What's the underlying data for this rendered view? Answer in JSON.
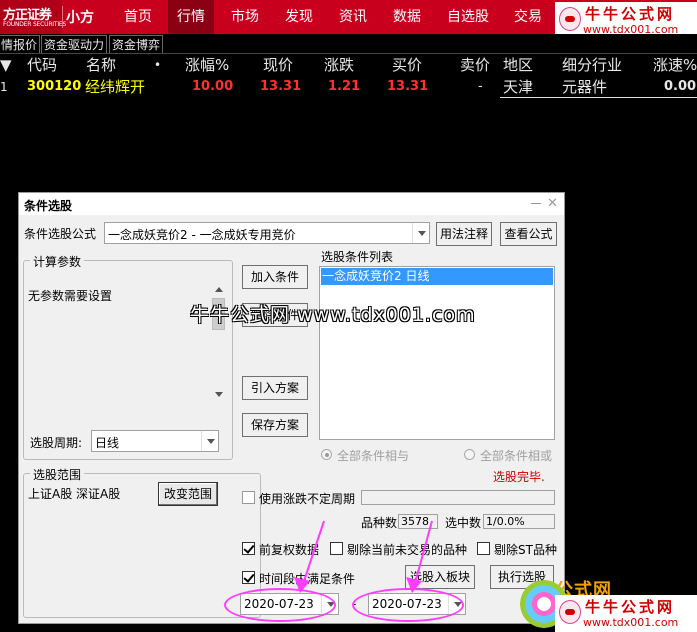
{
  "app": {
    "logo_main": "方正证券",
    "logo_sub": "FOUNDER SECURITIES",
    "logo_app": "小方"
  },
  "nav": {
    "items": [
      "首页",
      "行情",
      "市场",
      "发现",
      "资讯",
      "数据",
      "自选股",
      "交易"
    ],
    "active": "行情"
  },
  "brand": {
    "title": "牛牛公式网",
    "url": "www.tdx001.com"
  },
  "subtabs": [
    "情报价",
    "资金驱动力",
    "资金博弈"
  ],
  "table": {
    "headers": [
      "代码",
      "名称",
      "•",
      "涨幅%",
      "现价",
      "涨跌",
      "买价",
      "卖价",
      "地区",
      "细分行业",
      "涨速%"
    ],
    "row": {
      "index": "1",
      "code": "300120",
      "name": "经纬辉开",
      "change_pct": "10.00",
      "price": "13.31",
      "change": "1.21",
      "bid": "13.31",
      "ask": "-",
      "region": "天津",
      "industry": "元器件",
      "speed": "0.00"
    }
  },
  "dialog": {
    "title": "条件选股",
    "formula_label": "条件选股公式",
    "formula_value": "一念成妖竞价2 - 一念成妖专用竞价",
    "usage_button": "用法注释",
    "view_button": "查看公式",
    "params_group": "计算参数",
    "params_text": "无参数需要设置",
    "period_label": "选股周期:",
    "period_value": "日线",
    "add_condition": "加入条件",
    "delete_condition": "删除条件",
    "import_plan": "引入方案",
    "save_plan": "保存方案",
    "list_label": "选股条件列表",
    "list_item": "一念成妖竞价2  日线",
    "radio_and": "全部条件相与",
    "radio_or": "全部条件相或",
    "status": "选股完毕.",
    "scope_group": "选股范围",
    "scope_text": "上证A股 深证A股",
    "change_scope": "改变范围",
    "use_uncertain_period": "使用涨跌不定周期",
    "variety_label": "品种数",
    "variety_value": "3578",
    "selected_label": "选中数",
    "selected_value": "1/0.0%",
    "pre_adjust": "前复权数据",
    "exclude_untraded": "剔除当前未交易的品种",
    "exclude_st": "剔除ST品种",
    "time_range": "时间段内满足条件",
    "select_into_block": "选股入板块",
    "execute": "执行选股",
    "date_from": "2020-07-23",
    "date_to": "2020-07-23",
    "date_sep": "-"
  },
  "watermark": "牛牛公式网 www.tdx001.com",
  "bottom_brand": {
    "stamp": "公式网",
    "title": "牛牛公式网",
    "url": "www.tdx001.com"
  },
  "colors": {
    "nav_red": "#c8001e",
    "up_red": "#ff3030",
    "stock_yellow": "#ffff00",
    "industry_cyan": "#00d0d0",
    "annotation_magenta": "#ff3cff"
  }
}
